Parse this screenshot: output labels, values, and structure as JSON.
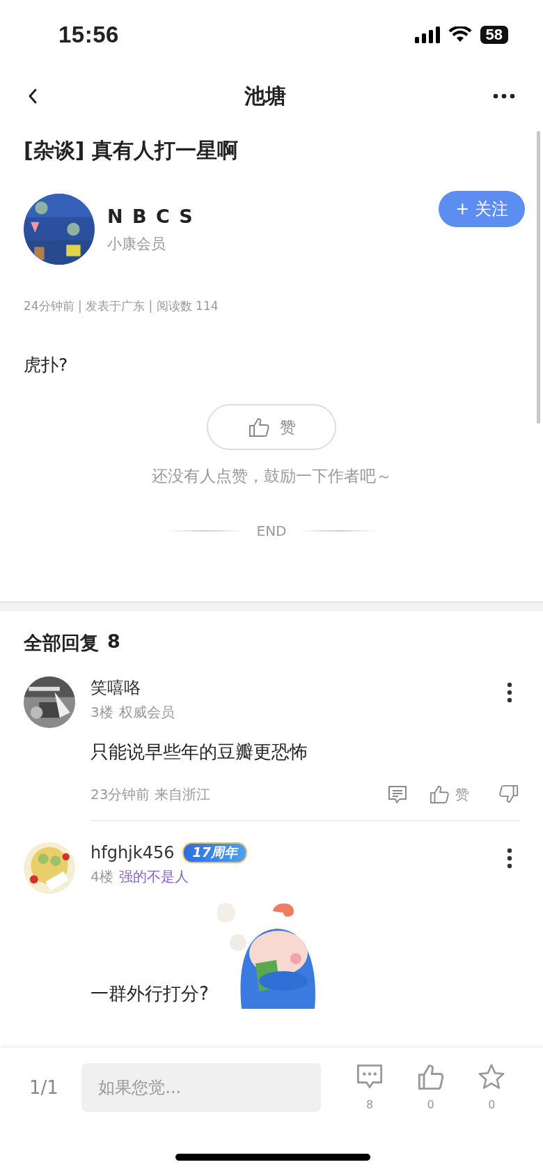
{
  "status_bar": {
    "time": "15:56",
    "battery": "58"
  },
  "nav": {
    "title": "池塘"
  },
  "post": {
    "title": "[杂谈] 真有人打一星啊",
    "author": {
      "name": "N B C S",
      "rank": "小康会员"
    },
    "follow_button": "+ 关注",
    "meta": "24分钟前 | 发表于广东 | 阅读数 114",
    "body": "虎扑?",
    "like_button": "赞",
    "like_hint": "还没有人点赞，鼓励一下作者吧～",
    "end_label": "END"
  },
  "replies": {
    "heading": "全部回复",
    "count": "8",
    "items": [
      {
        "name": "笑嘻咯",
        "floor": "3楼",
        "rank": "权威会员",
        "rank_highlight": false,
        "text": "只能说早些年的豆瓣更恐怖",
        "time": "23分钟前 来自浙江",
        "like_label": "赞",
        "sticker": false
      },
      {
        "name": "hfghjk456",
        "badge": "17周年",
        "floor": "4楼",
        "rank": "强的不是人",
        "rank_highlight": true,
        "text": "一群外行打分?",
        "sticker": true
      }
    ]
  },
  "bottom_bar": {
    "page": "1/1",
    "placeholder": "如果您觉...",
    "comment_count": "8",
    "like_count": "0",
    "favorite_count": "0"
  }
}
